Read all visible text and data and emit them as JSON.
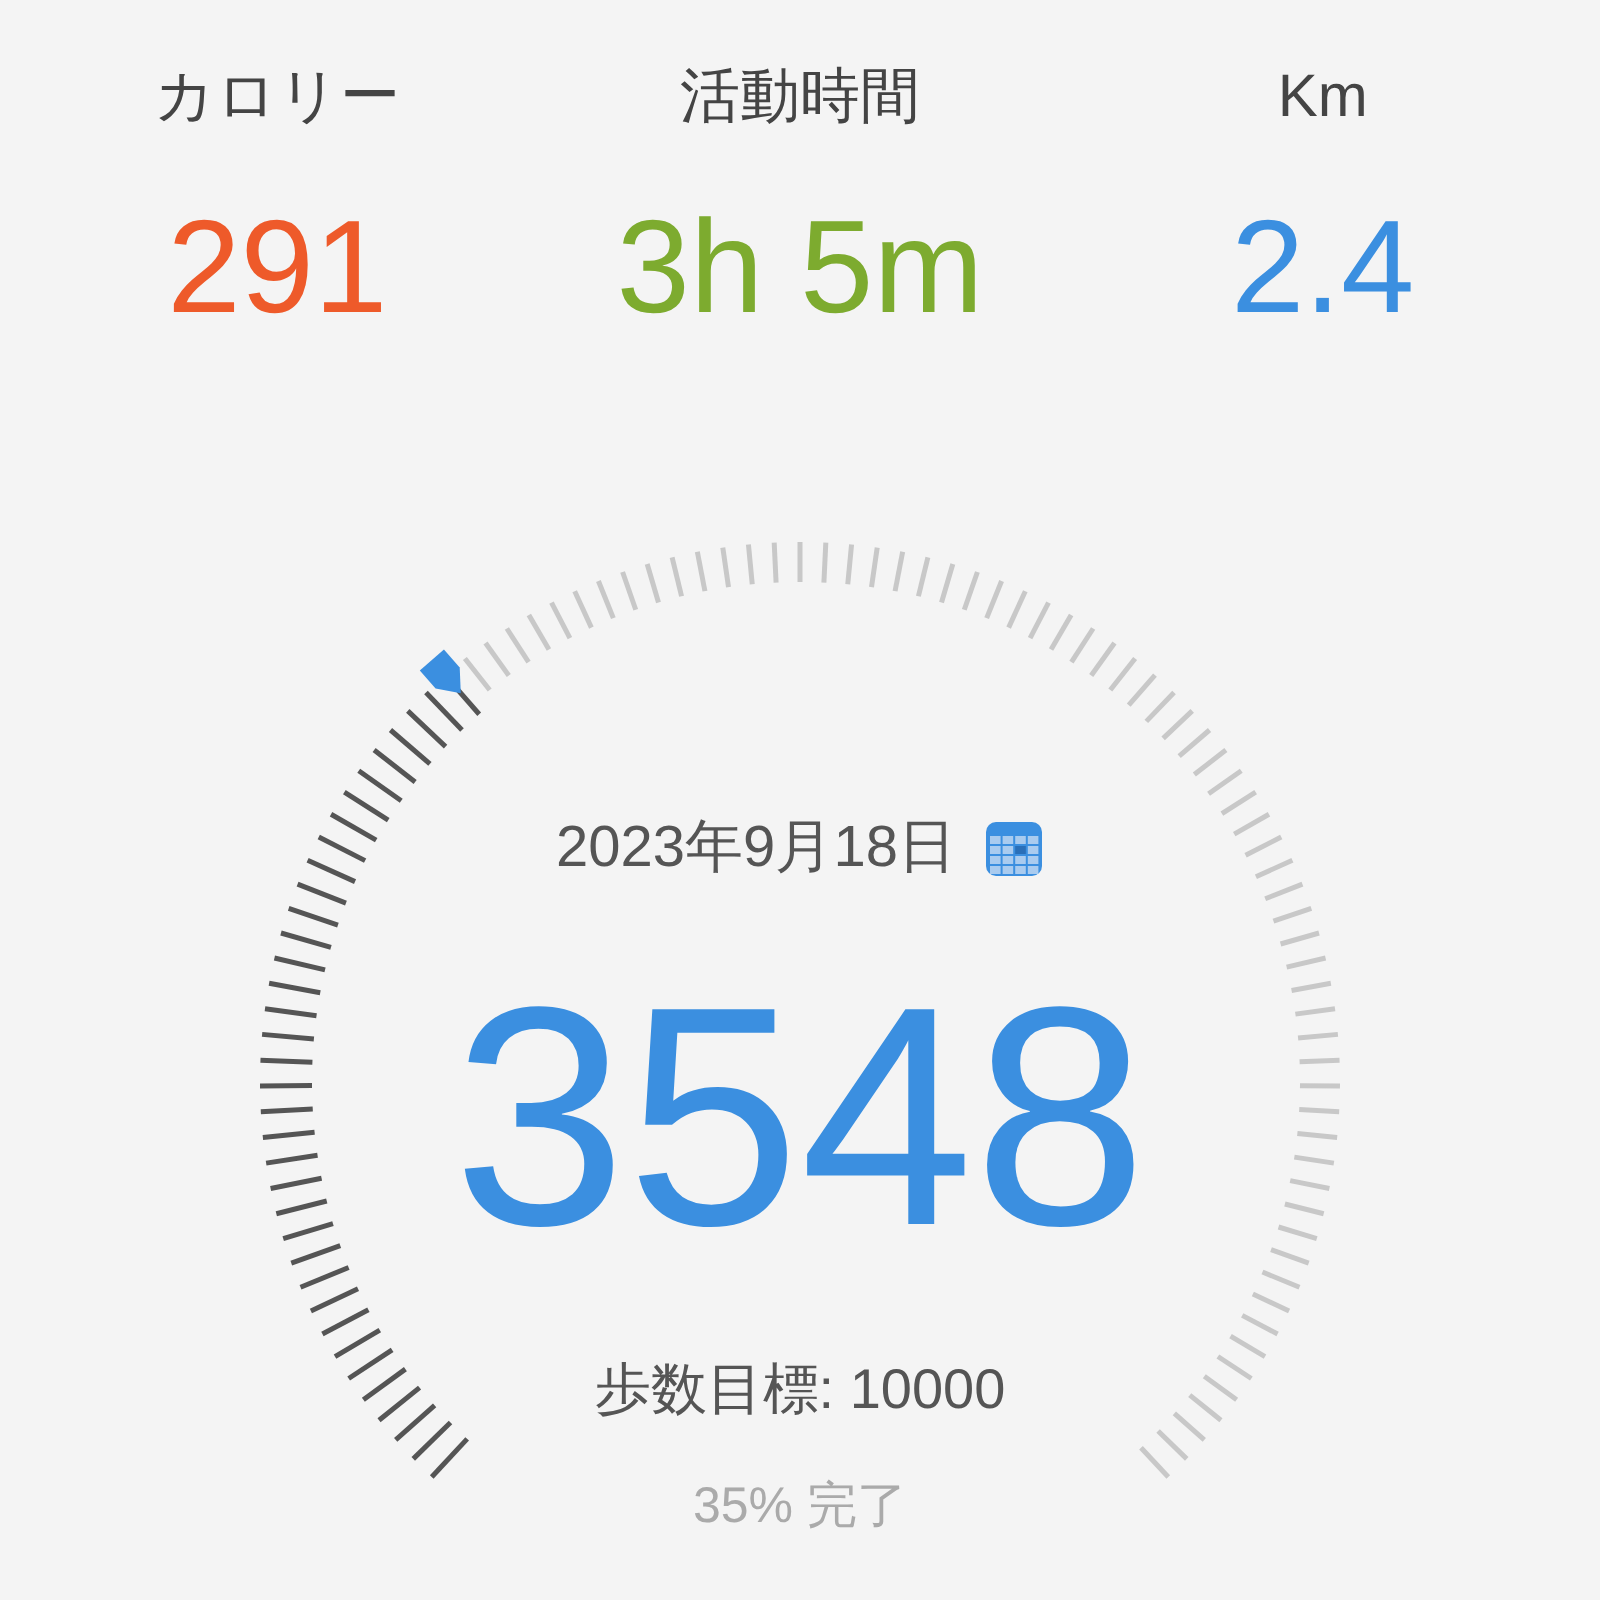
{
  "stats": [
    {
      "label": "カロリー",
      "value": "291",
      "color": "#ee5a2a"
    },
    {
      "label": "活動時間",
      "value": "3h 5m",
      "color": "#7dab2f"
    },
    {
      "label": "Km",
      "value": "2.4",
      "color": "#3b8fe0"
    }
  ],
  "gauge": {
    "date": "2023年9月18日",
    "steps": "3548",
    "goal": "歩数目標: 10000",
    "completion": "35% 完了"
  }
}
